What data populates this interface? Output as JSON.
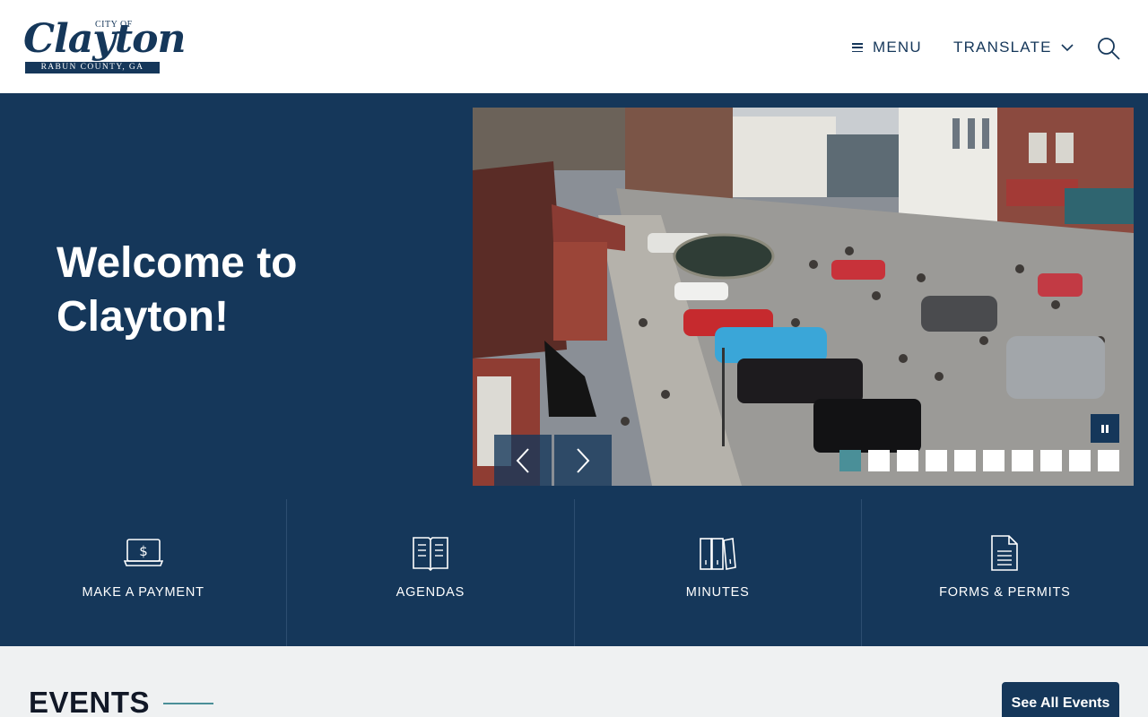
{
  "logo": {
    "city_of": "CITY OF",
    "name": "Clayton",
    "county": "RABUN COUNTY, GA"
  },
  "nav": {
    "menu_label": "MENU",
    "translate_label": "TRANSLATE",
    "search_icon": "search-icon"
  },
  "hero": {
    "title": "Welcome to Clayton!",
    "slide_image": "street-car-show-photo",
    "slide_count": 10,
    "active_slide": 1
  },
  "quick_links": [
    {
      "label": "MAKE A PAYMENT",
      "icon": "laptop-dollar-icon"
    },
    {
      "label": "AGENDAS",
      "icon": "open-book-icon"
    },
    {
      "label": "MINUTES",
      "icon": "binders-icon"
    },
    {
      "label": "FORMS & PERMITS",
      "icon": "document-icon"
    }
  ],
  "events": {
    "title": "EVENTS",
    "see_all_label": "See All Events"
  },
  "colors": {
    "brand_navy": "#15375a",
    "accent_teal": "#4a8f98",
    "events_bg": "#eff1f2"
  }
}
